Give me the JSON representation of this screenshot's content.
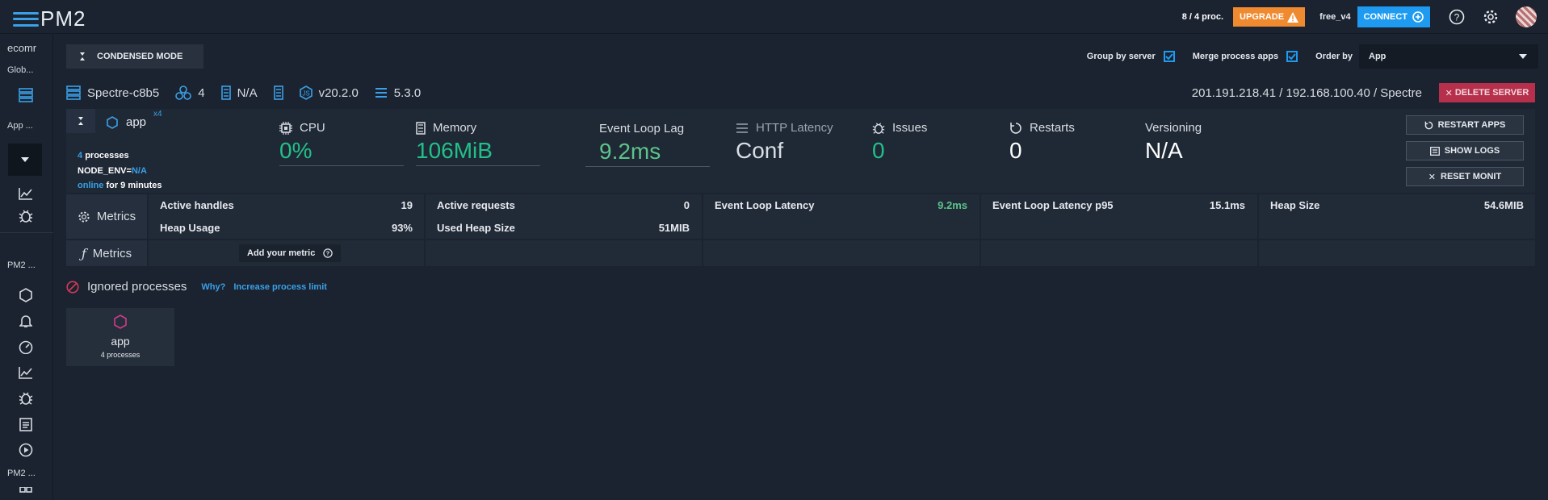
{
  "topbar": {
    "logo_text": "PM2",
    "proc_count": "8 / 4 proc.",
    "upgrade_label": "UPGRADE",
    "plan_name": "free_v4",
    "connect_label": "CONNECT"
  },
  "sidebar": {
    "bucket_label": "ecomr",
    "global_label": "Glob...",
    "app_label": "App ...",
    "pm2_label_1": "PM2 ...",
    "pm2_label_2": "PM2 ..."
  },
  "toolbar": {
    "condensed_mode_label": "CONDENSED MODE",
    "group_by_server_label": "Group by server",
    "group_by_server_checked": true,
    "merge_process_apps_label": "Merge process apps",
    "merge_process_apps_checked": true,
    "order_by_label": "Order by",
    "order_by_value": "App"
  },
  "server": {
    "name": "Spectre-c8b5",
    "cpu_cores": "4",
    "memory": "N/A",
    "node_version": "v20.2.0",
    "pm2_version": "5.3.0",
    "address": "201.191.218.41 / 192.168.100.40 / Spectre",
    "delete_label": "DELETE SERVER"
  },
  "app": {
    "name": "app",
    "instances_sup": "x4",
    "process_count": "4",
    "processes_label": "processes",
    "node_env_label": "NODE_ENV=",
    "node_env_value": "N/A",
    "status": "online",
    "uptime_text": "for 9 minutes"
  },
  "metrics": {
    "cpu": {
      "label": "CPU",
      "value": "0%"
    },
    "memory": {
      "label": "Memory",
      "value": "106MiB"
    },
    "event_loop_lag": {
      "label": "Event Loop Lag",
      "value": "9.2ms"
    },
    "http_latency": {
      "label": "HTTP Latency",
      "value": "Conf"
    },
    "issues": {
      "label": "Issues",
      "value": "0"
    },
    "restarts": {
      "label": "Restarts",
      "value": "0"
    },
    "versioning": {
      "label": "Versioning",
      "value": "N/A"
    }
  },
  "actions": {
    "restart_apps": "RESTART APPS",
    "show_logs": "SHOW LOGS",
    "reset_monit": "RESET MONIT"
  },
  "custom_metrics": {
    "row_label": "Metrics",
    "active_handles": {
      "label": "Active handles",
      "value": "19"
    },
    "heap_usage": {
      "label": "Heap Usage",
      "value": "93%"
    },
    "active_requests": {
      "label": "Active requests",
      "value": "0"
    },
    "used_heap_size": {
      "label": "Used Heap Size",
      "value": "51MIB"
    },
    "event_loop_latency": {
      "label": "Event Loop Latency",
      "value": "9.2ms"
    },
    "event_loop_latency_p95": {
      "label": "Event Loop Latency p95",
      "value": "15.1ms"
    },
    "heap_size": {
      "label": "Heap Size",
      "value": "54.6MIB"
    }
  },
  "functions_row": {
    "row_label": "Metrics",
    "add_metric_label": "Add your metric"
  },
  "ignored": {
    "title": "Ignored processes",
    "why_link": "Why?",
    "increase_link": "Increase process limit",
    "card_name": "app",
    "card_sub": "4 processes"
  },
  "colors": {
    "background": "#1b2330",
    "accent_blue": "#1e9bf0",
    "upgrade_orange": "#f08a30",
    "delete_red": "#b6304b",
    "metric_green": "#22c089"
  }
}
